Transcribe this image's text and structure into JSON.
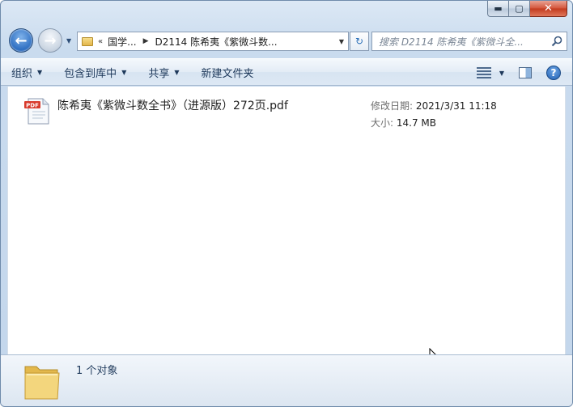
{
  "window": {
    "controls": {
      "minimize": "▬",
      "maximize": "▢",
      "close": "✕"
    }
  },
  "nav": {
    "breadcrumb_chevron": "«",
    "breadcrumb": [
      "国学...",
      "D2114 陈希夷《紫微斗数..."
    ],
    "search_placeholder": "搜索 D2114 陈希夷《紫微斗全...",
    "refresh_symbol": "↻"
  },
  "toolbar": {
    "items": [
      {
        "label": "组织",
        "dropdown": true
      },
      {
        "label": "包含到库中",
        "dropdown": true
      },
      {
        "label": "共享",
        "dropdown": true
      },
      {
        "label": "新建文件夹",
        "dropdown": false
      }
    ],
    "help_symbol": "?"
  },
  "files": [
    {
      "name": "陈希夷《紫微斗数全书》（进源版）272页.pdf",
      "icon": "pdf-file-icon",
      "modified_label": "修改日期:",
      "modified": "2021/3/31 11:18",
      "size_label": "大小:",
      "size": "14.7 MB"
    }
  ],
  "status": {
    "count_text": "1 个对象"
  },
  "colors": {
    "pdf_red": "#d83b2d",
    "accent_blue": "#2b6cc0",
    "folder_yellow": "#e8bd4f"
  }
}
